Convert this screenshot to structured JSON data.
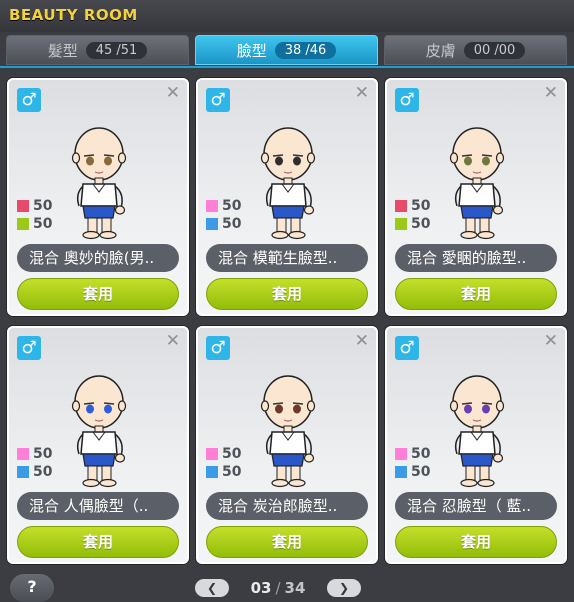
{
  "window": {
    "title": "BEAUTY ROOM"
  },
  "tabs": [
    {
      "label": "髮型",
      "count": "45 /51",
      "active": false
    },
    {
      "label": "臉型",
      "count": "38 /46",
      "active": true
    },
    {
      "label": "皮膚",
      "count": "00 /00",
      "active": false
    }
  ],
  "cards": [
    {
      "gender_symbol": "♂",
      "stat1": "50",
      "stat2": "50",
      "color1": "#e84a6a",
      "color2": "#9cc81a",
      "name": "混合 奧妙的臉(男..",
      "apply_label": "套用",
      "eye_color": "#8a6a3a"
    },
    {
      "gender_symbol": "♂",
      "stat1": "50",
      "stat2": "50",
      "color1": "#ff7ed6",
      "color2": "#3c9be6",
      "name": "混合 模範生臉型..",
      "apply_label": "套用",
      "eye_color": "#2f2f2f"
    },
    {
      "gender_symbol": "♂",
      "stat1": "50",
      "stat2": "50",
      "color1": "#e84a6a",
      "color2": "#9cc81a",
      "name": "混合 愛睏的臉型..",
      "apply_label": "套用",
      "eye_color": "#6f7a3a"
    },
    {
      "gender_symbol": "♂",
      "stat1": "50",
      "stat2": "50",
      "color1": "#ff7ed6",
      "color2": "#3c9be6",
      "name": "混合 人偶臉型（..",
      "apply_label": "套用",
      "eye_color": "#2f5fd8"
    },
    {
      "gender_symbol": "♂",
      "stat1": "50",
      "stat2": "50",
      "color1": "#ff7ed6",
      "color2": "#3c9be6",
      "name": "混合 炭治郎臉型..",
      "apply_label": "套用",
      "eye_color": "#6a3a2a"
    },
    {
      "gender_symbol": "♂",
      "stat1": "50",
      "stat2": "50",
      "color1": "#ff7ed6",
      "color2": "#3c9be6",
      "name": "混合 忍臉型（ 藍..",
      "apply_label": "套用",
      "eye_color": "#6b3fb0"
    }
  ],
  "footer": {
    "help_label": "?",
    "prev_icon": "chevron-left-icon",
    "next_icon": "chevron-right-icon",
    "current_page": "03",
    "separator": "/",
    "total_pages": "34"
  }
}
